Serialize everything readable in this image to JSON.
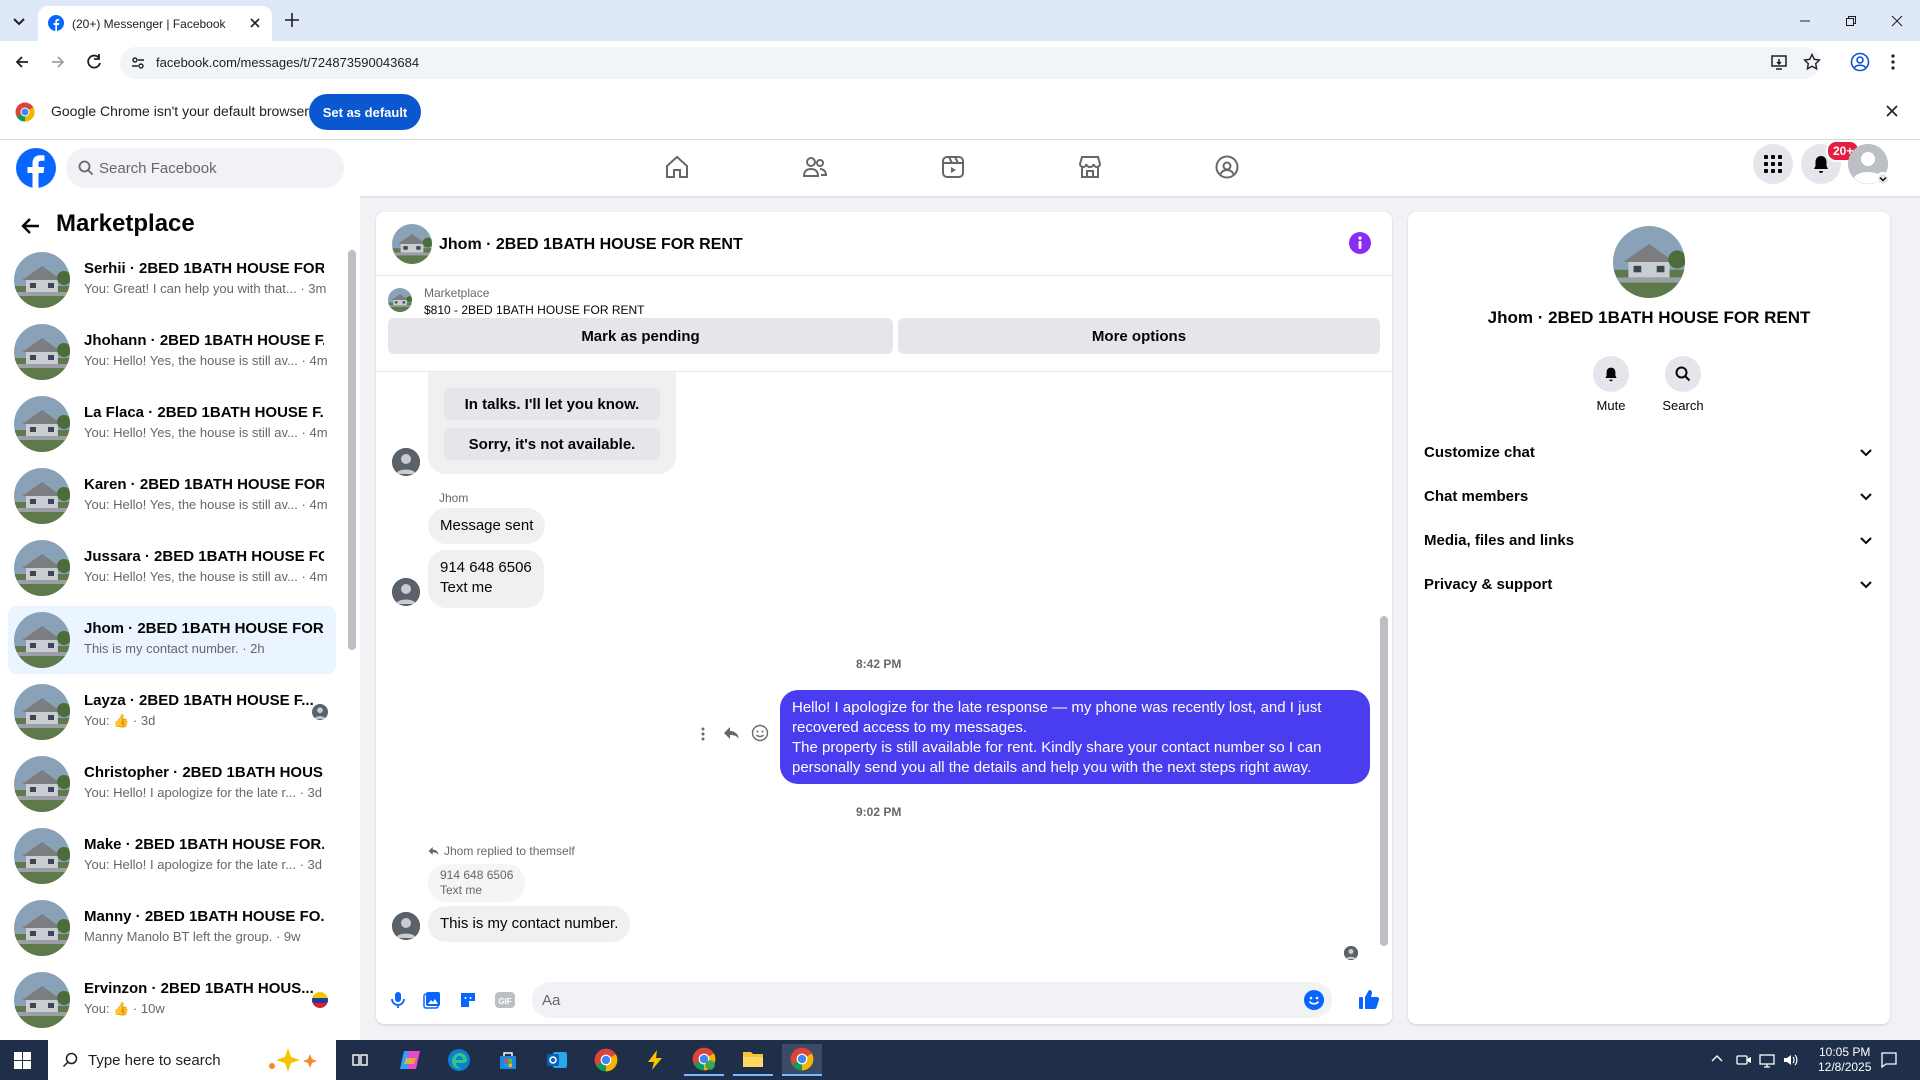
{
  "browser": {
    "tab_title": "(20+) Messenger | Facebook",
    "url": "facebook.com/messages/t/724873590043684",
    "infobar_message": "Google Chrome isn't your default browser",
    "set_default_label": "Set as default"
  },
  "fb": {
    "search_placeholder": "Search Facebook",
    "notification_count": "20+"
  },
  "sidebar": {
    "title": "Marketplace",
    "conversations": [
      {
        "name": "Serhii · 2BED 1BATH HOUSE FOR...",
        "preview": "You: Great! I can help you with that... · 3m"
      },
      {
        "name": "Jhohann · 2BED 1BATH HOUSE F...",
        "preview": "You: Hello! Yes, the house is still av... · 4m"
      },
      {
        "name": "La Flaca · 2BED 1BATH HOUSE F...",
        "preview": "You: Hello! Yes, the house is still av... · 4m"
      },
      {
        "name": "Karen · 2BED 1BATH HOUSE FOR...",
        "preview": "You: Hello! Yes, the house is still av... · 4m"
      },
      {
        "name": "Jussara · 2BED 1BATH HOUSE FO...",
        "preview": "You: Hello! Yes, the house is still av... · 4m"
      },
      {
        "name": "Jhom · 2BED 1BATH HOUSE FOR...",
        "preview": "This is my contact number. · 2h"
      },
      {
        "name": "Layza · 2BED 1BATH HOUSE F...",
        "preview": "You: 👍 · 3d"
      },
      {
        "name": "Christopher · 2BED 1BATH HOUS...",
        "preview": "You: Hello! I apologize for the late r... · 3d"
      },
      {
        "name": "Make · 2BED 1BATH HOUSE FOR...",
        "preview": "You: Hello! I apologize for the late r... · 3d"
      },
      {
        "name": "Manny · 2BED 1BATH HOUSE FO...",
        "preview": "Manny Manolo BT left the group. · 9w"
      },
      {
        "name": "Ervinzon · 2BED 1BATH HOUS...",
        "preview": "You: 👍 · 10w"
      }
    ]
  },
  "chat": {
    "title": "Jhom · 2BED 1BATH HOUSE FOR RENT",
    "marketplace_label": "Marketplace",
    "listing": "$810 - 2BED 1BATH HOUSE FOR RENT",
    "mark_pending": "Mark as pending",
    "more_options": "More options",
    "quick_reply_1": "In talks. I'll let you know.",
    "quick_reply_2": "Sorry, it's not available.",
    "sender_name": "Jhom",
    "msg_sent": "Message sent",
    "msg_phone": "914 648 6506",
    "msg_text_me": "Text me",
    "time_1": "8:42 PM",
    "my_message_line1": "Hello! I apologize for the late response — my phone was recently lost, and I just recovered access to my messages.",
    "my_message_line2": "The property is still available for rent. Kindly share your contact number so I can personally send you all the details and help you with the next steps right away.",
    "time_2": "9:02 PM",
    "reply_note": "Jhom replied to themself",
    "quoted_phone": "914 648 6506",
    "quoted_text": "Text me",
    "last_message": "This is my contact number.",
    "composer_placeholder": "Aa"
  },
  "details": {
    "title": "Jhom · 2BED 1BATH HOUSE FOR RENT",
    "mute_label": "Mute",
    "search_label": "Search",
    "sections": [
      "Customize chat",
      "Chat members",
      "Media, files and links",
      "Privacy & support"
    ]
  },
  "taskbar": {
    "search_placeholder": "Type here to search",
    "time": "10:05 PM",
    "date": "12/8/2025"
  },
  "colors": {
    "fb_blue": "#0866ff",
    "my_bubble": "#4a3df0",
    "accent_purple": "#8b2cf5",
    "badge_red": "#e41e3f"
  }
}
